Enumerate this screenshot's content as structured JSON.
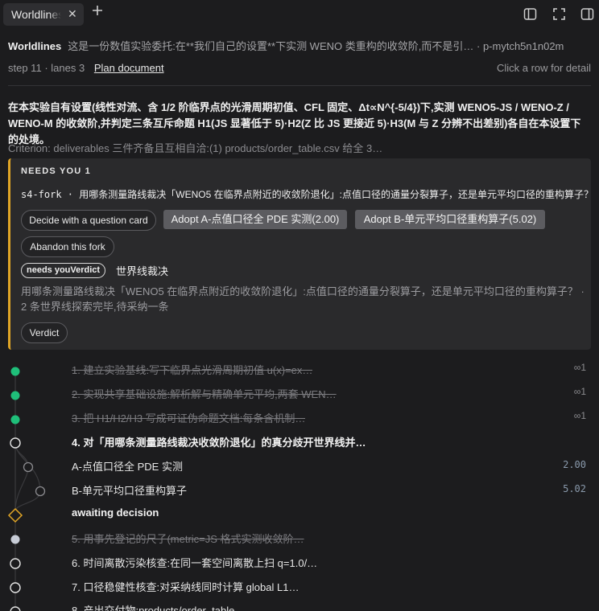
{
  "tab": {
    "label": "Worldlines",
    "close": "✕",
    "add": "+"
  },
  "header": {
    "title": "Worldlines",
    "description": "这是一份数值实验委托:在**我们自己的设置**下实测 WENO 类重构的收敛阶,而不是引…",
    "separator": "·",
    "id": "p-mytch5n1n02m",
    "step": "step 11",
    "lanes": "lanes 3",
    "plan_link": "Plan document",
    "hint": "Click a row for detail"
  },
  "goal": "在本实验自有设置(线性对流、含 1/2 阶临界点的光滑周期初值、CFL 固定、Δt∝N^{-5/4})下,实测 WENO5-JS / WENO-Z / WENO-M 的收敛阶,并判定三条互斥命题 H1(JS 显著低于 5)·H2(Z 比 JS 更接近 5)·H3(M 与 Z 分辨不出差别)各自在本设置下的处境。",
  "criterion": "Criterion: deliverables 三件齐备且互相自洽:(1) products/order_table.csv 给全 3…",
  "needs_card": {
    "heading": "NEEDS YOU 1",
    "question_id": "s4-fork",
    "question_sep": " · ",
    "question": "用哪条测量路线裁决「WENO5 在临界点附近的收敛阶退化」:点值口径的通量分裂算子，还是单元平均口径的重构算子？",
    "btn_question_card": "Decide with a question card",
    "btn_adopt_a": "Adopt A-点值口径全 PDE 实测(2.00)",
    "btn_adopt_b": "Adopt B-单元平均口径重构算子(5.02)",
    "btn_abandon": "Abandon this fork",
    "pill": "needs youVerdict",
    "verdict_label": "世界线裁决",
    "description": "用哪条测量路线裁决「WENO5 在临界点附近的收敛阶退化」:点值口径的通量分裂算子，还是单元平均口径的重构算子？ · 2 条世界线探索完毕,待采纳一条",
    "btn_verdict": "Verdict"
  },
  "timeline": [
    {
      "label": "1. 建立实验基线:写下临界点光滑周期初值 u(x)=ex…",
      "state": "done",
      "value": "∞1"
    },
    {
      "label": "2. 实现共享基础设施:解析解与精确单元平均,两套 WEN…",
      "state": "done",
      "value": "∞1"
    },
    {
      "label": "3. 把 H1/H2/H3 写成可证伪命题文档:每条含机制…",
      "state": "done",
      "value": "∞1"
    },
    {
      "label": "4. 对「用哪条测量路线裁决收敛阶退化」的真分歧开世界线并…",
      "state": "active",
      "value": ""
    },
    {
      "label": "A-点值口径全 PDE 实测",
      "state": "normal",
      "value": "2.00"
    },
    {
      "label": "B-单元平均口径重构算子",
      "state": "normal",
      "value": "5.02"
    },
    {
      "label": "awaiting decision",
      "state": "active",
      "value": ""
    },
    {
      "label": "5. 用事先登记的尺子(metric=JS 格式实测收敛阶…",
      "state": "done",
      "value": ""
    },
    {
      "label": "6. 时间离散污染核查:在同一套空间离散上扫 q=1.0/…",
      "state": "normal",
      "value": ""
    },
    {
      "label": "7. 口径稳健性核查:对采纳线同时计算 global L1…",
      "state": "normal",
      "value": ""
    },
    {
      "label": "8. 产出交付物:products/order_table…",
      "state": "normal",
      "value": ""
    }
  ],
  "colors": {
    "accent": "#e0a526",
    "done_dot": "#1fbf7a",
    "bg": "#1c1c1e",
    "card": "#2a2a2c"
  },
  "icons": [
    "plus-icon",
    "close-icon",
    "sidebar-left-icon",
    "fullscreen-icon",
    "sidebar-right-icon"
  ]
}
